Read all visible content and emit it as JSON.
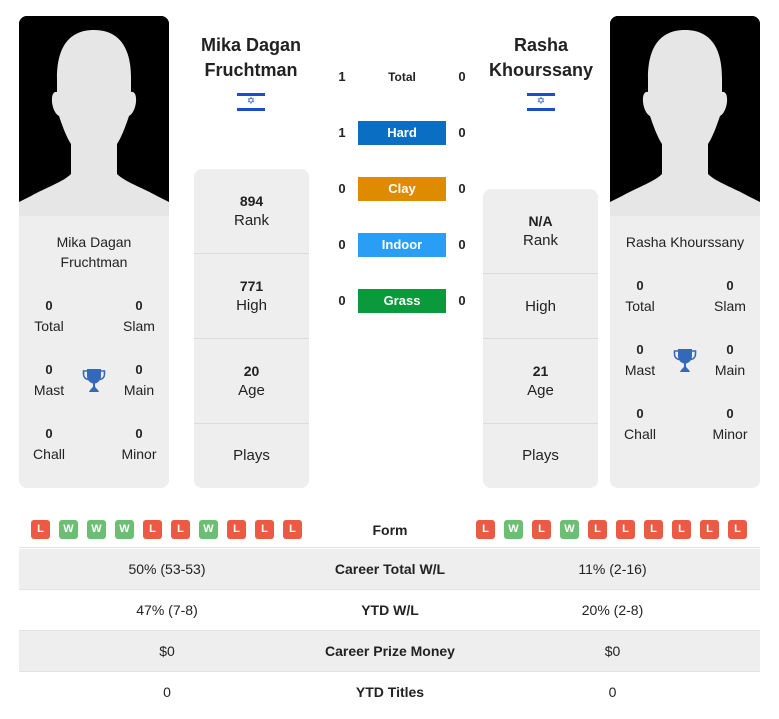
{
  "colors": {
    "hard": "#0a6fc2",
    "clay": "#df8b00",
    "indoor": "#2a9df4",
    "grass": "#0b9a3b",
    "loss": "#ec5a45",
    "win": "#6cbf72",
    "trophy": "#3468b8",
    "flag_blue": "#1a4fc6"
  },
  "player1": {
    "name": "Mika Dagan Fruchtman",
    "name_line1": "Mika Dagan",
    "name_line2": "Fruchtman",
    "card_name_line1": "Mika Dagan",
    "card_name_line2": "Fruchtman",
    "flag": "israel-flag",
    "titles": {
      "total": {
        "value": "0",
        "label": "Total"
      },
      "slam": {
        "value": "0",
        "label": "Slam"
      },
      "mast": {
        "value": "0",
        "label": "Mast"
      },
      "main": {
        "value": "0",
        "label": "Main"
      },
      "chall": {
        "value": "0",
        "label": "Chall"
      },
      "minor": {
        "value": "0",
        "label": "Minor"
      }
    },
    "rank": {
      "value": "894",
      "label": "Rank"
    },
    "high": {
      "value": "771",
      "label": "High"
    },
    "age": {
      "value": "20",
      "label": "Age"
    },
    "plays": {
      "value": "",
      "label": "Plays"
    },
    "form": [
      "L",
      "W",
      "W",
      "W",
      "L",
      "L",
      "W",
      "L",
      "L",
      "L"
    ]
  },
  "player2": {
    "name": "Rasha Khourssany",
    "name_line1": "Rasha",
    "name_line2": "Khourssany",
    "card_name_line1": "Rasha Khourssany",
    "flag": "israel-flag",
    "titles": {
      "total": {
        "value": "0",
        "label": "Total"
      },
      "slam": {
        "value": "0",
        "label": "Slam"
      },
      "mast": {
        "value": "0",
        "label": "Mast"
      },
      "main": {
        "value": "0",
        "label": "Main"
      },
      "chall": {
        "value": "0",
        "label": "Chall"
      },
      "minor": {
        "value": "0",
        "label": "Minor"
      }
    },
    "rank": {
      "value": "N/A",
      "label": "Rank"
    },
    "high": {
      "value": "",
      "label": "High"
    },
    "age": {
      "value": "21",
      "label": "Age"
    },
    "plays": {
      "value": "",
      "label": "Plays"
    },
    "form": [
      "L",
      "W",
      "L",
      "W",
      "L",
      "L",
      "L",
      "L",
      "L",
      "L"
    ]
  },
  "h2h": [
    {
      "surface": "Total",
      "p1": "1",
      "p2": "0"
    },
    {
      "surface": "Hard",
      "p1": "1",
      "p2": "0"
    },
    {
      "surface": "Clay",
      "p1": "0",
      "p2": "0"
    },
    {
      "surface": "Indoor",
      "p1": "0",
      "p2": "0"
    },
    {
      "surface": "Grass",
      "p1": "0",
      "p2": "0"
    }
  ],
  "form_label": "Form",
  "stats": [
    {
      "label": "Career Total W/L",
      "p1": "50% (53-53)",
      "p2": "11% (2-16)"
    },
    {
      "label": "YTD W/L",
      "p1": "47% (7-8)",
      "p2": "20% (2-8)"
    },
    {
      "label": "Career Prize Money",
      "p1": "$0",
      "p2": "$0"
    },
    {
      "label": "YTD Titles",
      "p1": "0",
      "p2": "0"
    }
  ]
}
